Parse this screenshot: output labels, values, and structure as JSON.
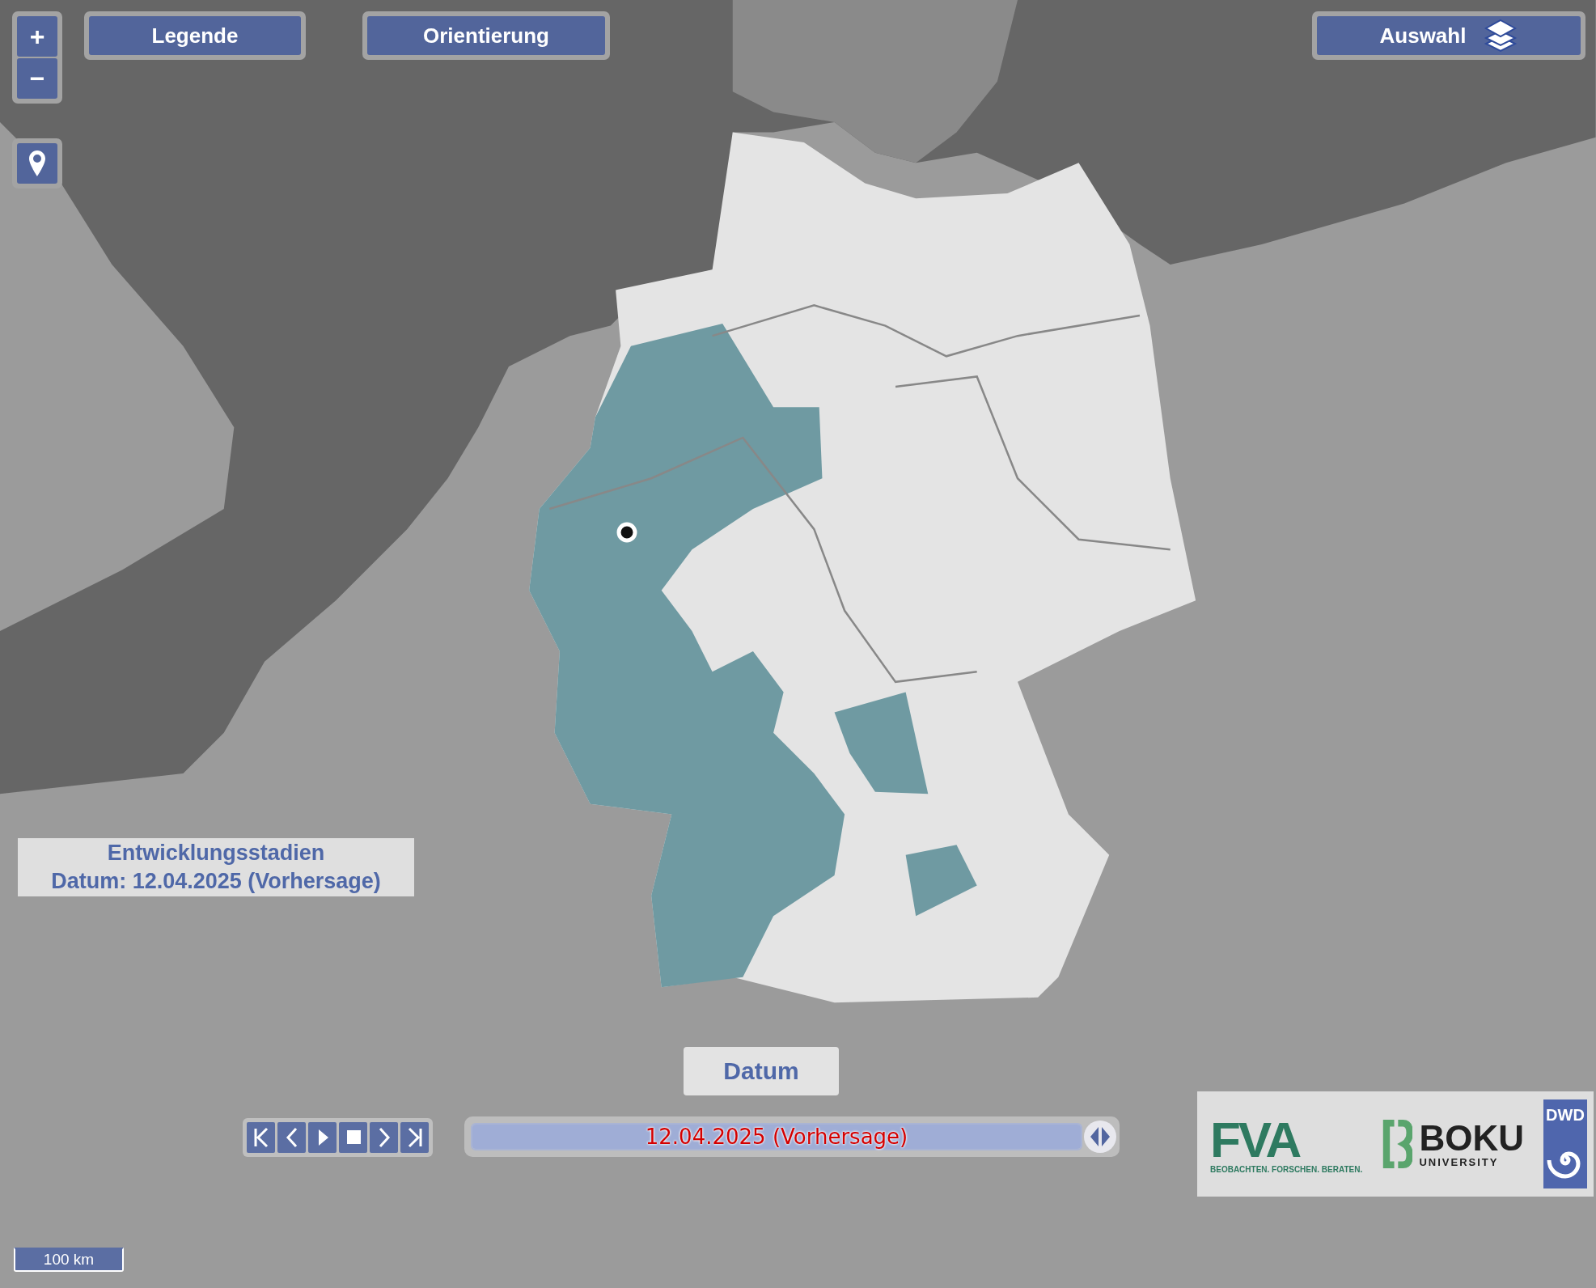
{
  "zoom_controls": {
    "zoom_in": "+",
    "zoom_out": "−"
  },
  "top_buttons": [
    {
      "kind": "plain",
      "label": "Legende"
    },
    {
      "kind": "plain",
      "label": "Orientierung"
    },
    {
      "kind": "layers",
      "label": "Auswahl"
    }
  ],
  "info_panel": {
    "title": "Entwicklungsstadien",
    "date_line": "Datum: 12.04.2025 (Vorhersage)"
  },
  "date_label": "Datum",
  "player_buttons": [
    {
      "kind": "first"
    },
    {
      "kind": "prev"
    },
    {
      "kind": "play"
    },
    {
      "kind": "stop"
    },
    {
      "kind": "next"
    },
    {
      "kind": "last"
    }
  ],
  "date_slider": {
    "value": "12.04.2025 (Vorhersage)",
    "level": 1
  },
  "logos": {
    "fva": "FVA",
    "fva_tagline": "BEOBACHTEN. FORSCHEN. BERATEN.",
    "boku": "BOKU",
    "boku_sub": "UNIVERSITY",
    "dwd": "DWD"
  },
  "scale_bar": "100 km"
}
